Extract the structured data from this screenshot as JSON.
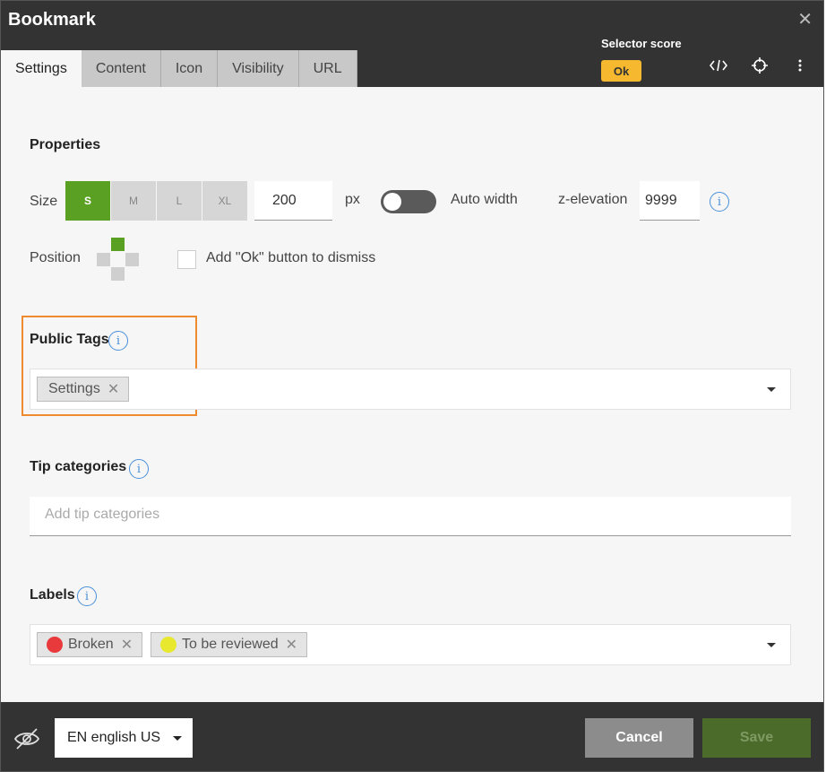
{
  "dialog": {
    "title": "Bookmark",
    "close_symbol": "✕"
  },
  "tabs": [
    {
      "label": "Settings",
      "active": true
    },
    {
      "label": "Content"
    },
    {
      "label": "Icon"
    },
    {
      "label": "Visibility"
    },
    {
      "label": "URL"
    }
  ],
  "selector": {
    "label": "Selector score",
    "badge": "Ok",
    "badge_color": "#f5b82e"
  },
  "header_icons": [
    "code-icon",
    "crosshair-icon",
    "more-vertical-icon"
  ],
  "properties": {
    "title": "Properties",
    "size_label": "Size",
    "sizes": [
      "S",
      "M",
      "L",
      "XL"
    ],
    "selected_size": "S",
    "width_value": "200",
    "unit": "px",
    "auto_width_label": "Auto width",
    "auto_width_on": false,
    "z_elevation_label": "z-elevation",
    "z_elevation_value": "9999",
    "position_label": "Position",
    "position_selected": "top",
    "dismiss_label": "Add \"Ok\" button to dismiss"
  },
  "public_tags": {
    "title": "Public Tags",
    "tags": [
      {
        "label": "Settings"
      }
    ],
    "highlight_color": "#f08a2e"
  },
  "tip_categories": {
    "title": "Tip categories",
    "placeholder": "Add tip categories"
  },
  "labels": {
    "title": "Labels",
    "items": [
      {
        "label": "Broken",
        "color": "#e8393c"
      },
      {
        "label": "To be reviewed",
        "color": "#e8e82e"
      }
    ]
  },
  "footer": {
    "language": "EN english US",
    "cancel": "Cancel",
    "save": "Save"
  },
  "colors": {
    "accent": "#5aa022",
    "header_bg": "#333333",
    "info": "#4a90d9"
  }
}
